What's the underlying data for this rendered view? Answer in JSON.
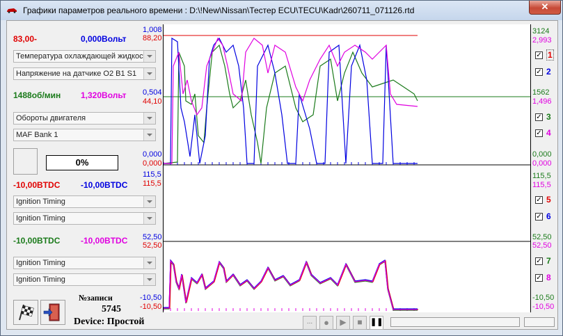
{
  "window": {
    "title": "Графики параметров реального времени : D:\\!New\\Nissan\\Тестер ECU\\TECU\\Kadr\\260711_071126.rtd",
    "close": "✕"
  },
  "group1": {
    "val_a": "83,00-",
    "val_b": "0,000Вольт",
    "sel_a": "Температура охлаждающей жидкости",
    "sel_b": "Напряжение на датчике O2 B1 S1",
    "val_c": "1488об/мин",
    "val_d": "1,320Вольт",
    "sel_c": "Обороты двигателя",
    "sel_d": "MAF Bank 1",
    "percent": "0%"
  },
  "group2": {
    "val_a": "-10,00BTDC",
    "val_b": "-10,00BTDC",
    "sel_a": "Ignition Timing",
    "sel_b": "Ignition Timing",
    "val_c": "-10,00BTDC",
    "val_d": "-10,00BTDC",
    "sel_c": "Ignition Timing",
    "sel_d": "Ignition Timing"
  },
  "records": {
    "label": "№записи",
    "value": "5745",
    "device": "Device: Простой"
  },
  "axes": {
    "p1_left_top": "1,008",
    "p1_left_top2": "88,20",
    "p1_left_mid": "0,504",
    "p1_left_mid2": "44,10",
    "p1_left_bot": "0,000",
    "p1_left_bot2": "0,000",
    "p1_right_top": "3124",
    "p1_right_top2": "2,993",
    "p1_right_mid": "1562",
    "p1_right_mid2": "1,496",
    "p1_right_bot": "0,000",
    "p1_right_bot2": "0,000",
    "p2_left_top": "115,5",
    "p2_left_top2": "115,5",
    "p2_right_top": "115,5",
    "p2_right_top2": "115,5",
    "p2_left_bot": "52,50",
    "p2_left_bot2": "52,50",
    "p2_right_bot": "52,50",
    "p2_right_bot2": "52,50",
    "p3_left_bot": "-10,50",
    "p3_left_bot2": "-10,50",
    "p3_right_bot": "-10,50",
    "p3_right_bot2": "-10,50"
  },
  "channels": [
    {
      "num": "1",
      "checked": true,
      "color": "#e00000"
    },
    {
      "num": "2",
      "checked": true,
      "color": "#0000e0"
    },
    {
      "num": "3",
      "checked": true,
      "color": "#1a7a1a"
    },
    {
      "num": "4",
      "checked": true,
      "color": "#e000e0"
    },
    {
      "num": "5",
      "checked": true,
      "color": "#e00000"
    },
    {
      "num": "6",
      "checked": true,
      "color": "#0000e0"
    },
    {
      "num": "7",
      "checked": true,
      "color": "#1a7a1a"
    },
    {
      "num": "8",
      "checked": true,
      "color": "#e000e0"
    }
  ],
  "playback": {
    "dots": "...",
    "record": "●",
    "play": "▶",
    "stop": "■",
    "pause": "❚❚"
  },
  "colors": {
    "red": "#e00000",
    "blue": "#0000e0",
    "green": "#1a7a1a",
    "magenta": "#e000e0"
  }
}
